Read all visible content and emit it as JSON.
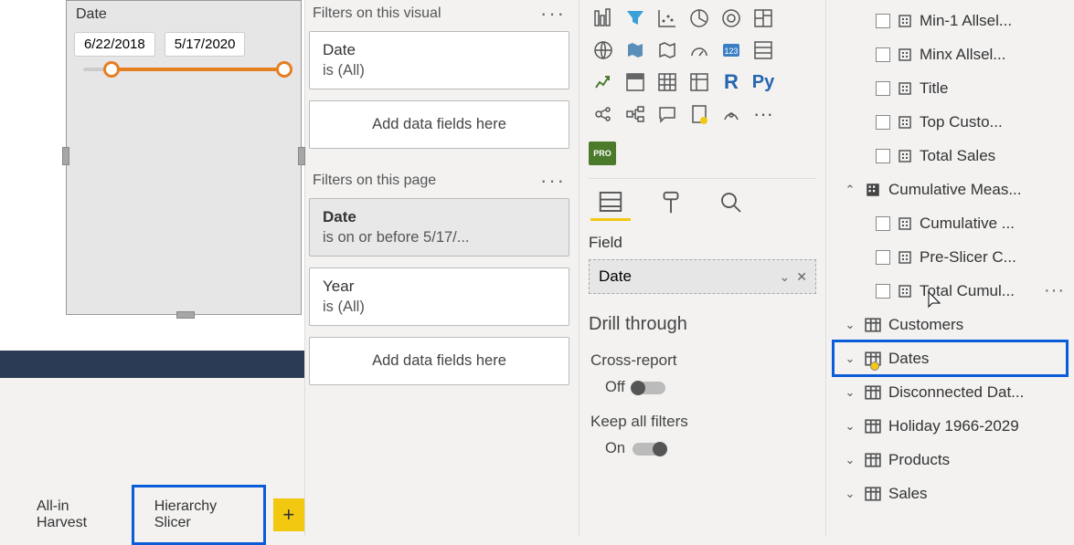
{
  "canvas": {
    "visual_title": "Date",
    "date_start": "6/22/2018",
    "date_end": "5/17/2020"
  },
  "tabs": {
    "t1": "All-in Harvest",
    "t2": "Hierarchy Slicer",
    "add_glyph": "+"
  },
  "filters": {
    "visual": {
      "heading": "Filters on this visual",
      "card1_name": "Date",
      "card1_cond": "is (All)",
      "drop": "Add data fields here"
    },
    "page": {
      "heading": "Filters on this page",
      "card1_name": "Date",
      "card1_cond": "is on or before 5/17/...",
      "card2_name": "Year",
      "card2_cond": "is (All)",
      "drop": "Add data fields here"
    }
  },
  "viz": {
    "r_label": "R",
    "py_label": "Py",
    "pro_label": "PRO",
    "dots": "···",
    "field_heading": "Field",
    "field_value": "Date",
    "field_chev": "⌄",
    "field_x": "✕",
    "drill_heading": "Drill through",
    "cross_label": "Cross-report",
    "cross_state": "Off",
    "keep_label": "Keep all filters",
    "keep_state": "On"
  },
  "fields": {
    "m1": "Min-1 Allsel...",
    "m2": "Minx Allsel...",
    "m3": "Title",
    "m4": "Top Custo...",
    "m5": "Total Sales",
    "grp1": "Cumulative Meas...",
    "g1a": "Cumulative ...",
    "g1b": "Pre-Slicer C...",
    "g1c": "Total Cumul...",
    "t1": "Customers",
    "t2": "Dates",
    "t3": "Disconnected Dat...",
    "t4": "Holiday 1966-2029",
    "t5": "Products",
    "t6": "Sales"
  }
}
